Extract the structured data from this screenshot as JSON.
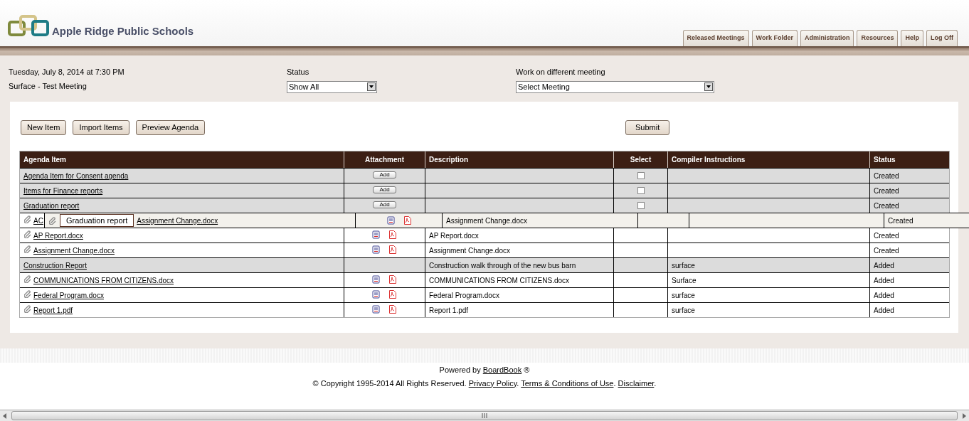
{
  "header": {
    "school_name": "Apple Ridge Public Schools"
  },
  "tabs": [
    {
      "label": "Released Meetings"
    },
    {
      "label": "Work Folder"
    },
    {
      "label": "Administration"
    },
    {
      "label": "Resources"
    },
    {
      "label": "Help"
    },
    {
      "label": "Log Off"
    }
  ],
  "meeting": {
    "date": "Tuesday, July 8, 2014 at 7:30 PM",
    "name": "Surface - Test Meeting"
  },
  "status_filter": {
    "label": "Status",
    "value": "Show All"
  },
  "meeting_select": {
    "label": "Work on different meeting",
    "value": "Select Meeting"
  },
  "buttons": [
    "New Item",
    "Import Items",
    "Preview Agenda"
  ],
  "submit_button": "Submit",
  "table": {
    "columns": [
      "Agenda Item",
      "Attachment",
      "Description",
      "Select",
      "Compiler Instructions",
      "Status"
    ],
    "rows": [
      {
        "title": "Agenda Item for Consent agenda",
        "add_button": "Add",
        "select": {
          "checked": false
        },
        "status": "Created"
      },
      {
        "title": "Items for Finance reports",
        "add_button": "Add",
        "select": {
          "checked": false
        },
        "status": "Created"
      },
      {
        "title": "Graduation report",
        "add_button": "Add",
        "select": {
          "checked": false
        },
        "status": "Created",
        "children": [
          {
            "kind": "covered",
            "name": "AC",
            "dragged": {
              "kind": "file",
              "tooltip": "Graduation report",
              "name": "Assignment Change.docx",
              "description": "Assignment Change.docx",
              "status": "Created"
            }
          },
          {
            "kind": "file",
            "name": "AP Report.docx",
            "description": "AP Report.docx",
            "status": "Created"
          },
          {
            "kind": "file",
            "name": "Assignment Change.docx",
            "description": "Assignment Change.docx",
            "status": "Created"
          }
        ]
      },
      {
        "title": "Construction Report",
        "description": "Construction walk through of the new bus barn",
        "compiler": "surface",
        "status": "Added",
        "children": [
          {
            "kind": "file",
            "name": "COMMUNICATIONS FROM CITIZENS.docx",
            "description": "COMMUNICATIONS FROM CITIZENS.docx",
            "compiler": "Surface",
            "status": "Added"
          },
          {
            "kind": "file",
            "name": "Federal Program.docx",
            "description": "Federal Program.docx",
            "compiler": "surface",
            "status": "Added"
          },
          {
            "kind": "file",
            "name": "Report 1.pdf",
            "description": "Report 1.pdf",
            "compiler": "surface",
            "status": "Added"
          }
        ]
      }
    ]
  },
  "footer": {
    "powered_prefix": "Powered by",
    "powered_link": "BoardBook",
    "powered_suffix": "®",
    "copyright": "© Copyright 1995-2014 All Rights Reserved.",
    "links": [
      {
        "label": "Privacy Policy",
        "after": "."
      },
      {
        "label": "Terms & Conditions of Use",
        "after": "."
      },
      {
        "label": "Disclaimer",
        "after": "."
      }
    ]
  }
}
